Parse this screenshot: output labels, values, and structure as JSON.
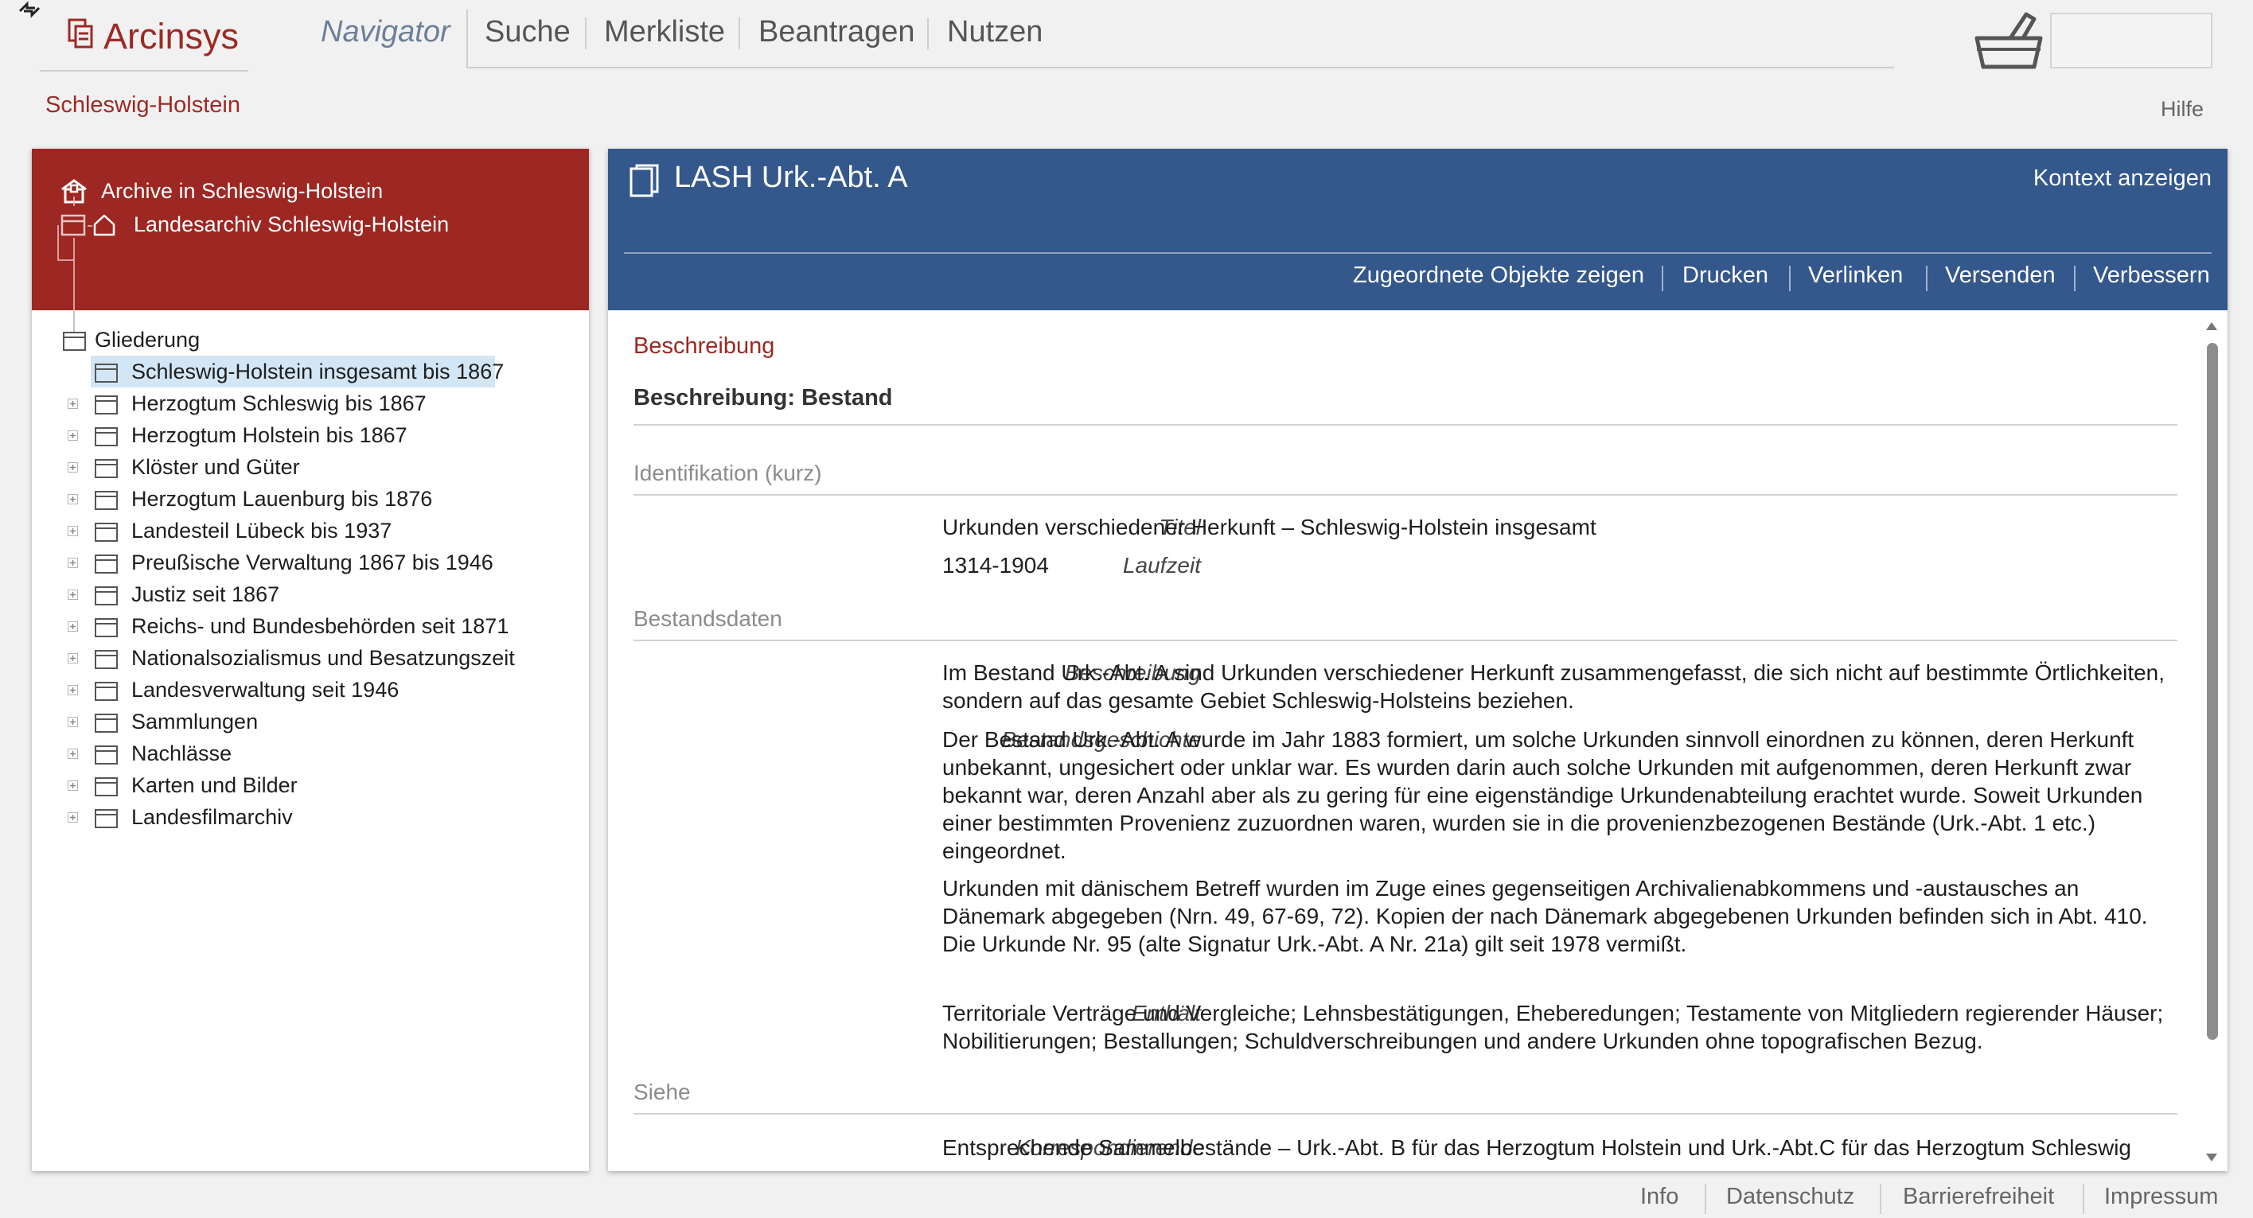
{
  "header": {
    "app_title": "Arcinsys",
    "region": "Schleswig-Holstein",
    "help": "Hilfe",
    "nav": {
      "navigator": "Navigator",
      "suche": "Suche",
      "merkliste": "Merkliste",
      "beantragen": "Beantragen",
      "nutzen": "Nutzen"
    }
  },
  "left_panel": {
    "archive_title": "Archive in Schleswig-Holstein",
    "landesarchiv": "Landesarchiv Schleswig-Holstein",
    "tree_root": "Gliederung",
    "tree_items": [
      "Schleswig-Holstein insgesamt bis 1867",
      "Herzogtum Schleswig bis 1867",
      "Herzogtum Holstein bis 1867",
      "Klöster und Güter",
      "Herzogtum Lauenburg bis 1876",
      "Landesteil Lübeck bis 1937",
      "Preußische Verwaltung 1867 bis 1946",
      "Justiz seit 1867",
      "Reichs- und Bundesbehörden seit 1871",
      "Nationalsozialismus und Besatzungszeit",
      "Landesverwaltung seit 1946",
      "Sammlungen",
      "Nachlässe",
      "Karten und Bilder",
      "Landesfilmarchiv"
    ]
  },
  "right_panel": {
    "title": "LASH Urk.-Abt. A",
    "context_link": "Kontext anzeigen",
    "actions": {
      "objects": "Zugeordnete Objekte zeigen",
      "print": "Drucken",
      "link": "Verlinken",
      "send": "Versenden",
      "improve": "Verbessern"
    },
    "section_title": "Beschreibung",
    "description_heading": "Beschreibung: Bestand",
    "groups": {
      "identification": "Identifikation (kurz)",
      "stock_data": "Bestandsdaten",
      "see": "Siehe"
    },
    "fields": {
      "titel": {
        "label": "Titel",
        "value": "Urkunden verschiedener Herkunft – Schleswig-Holstein insgesamt"
      },
      "laufzeit": {
        "label": "Laufzeit",
        "value": "1314-1904"
      },
      "beschreibung": {
        "label": "Beschreibung",
        "value": "Im Bestand Urk.-Abt. A sind Urkunden verschiedener Herkunft zusammengefasst, die sich nicht auf bestimmte Örtlichkeiten, sondern auf das gesamte Gebiet Schleswig-Holsteins beziehen."
      },
      "bestandsgeschichte": {
        "label": "Bestandsgeschichte",
        "paragraph1": "Der Bestand Urk.-Abt. A wurde im Jahr 1883 formiert, um solche Urkunden sinnvoll einordnen zu können, deren Herkunft unbekannt, ungesichert oder unklar war. Es wurden darin auch solche Urkunden mit aufgenommen, deren Herkunft zwar bekannt war, deren Anzahl aber als zu gering für eine eigenständige Urkundenabteilung erachtet wurde. Soweit Urkunden einer bestimmten Provenienz zuzuordnen waren, wurden sie in die provenienzbezogenen Bestände (Urk.-Abt. 1 etc.) eingeordnet.",
        "paragraph2": "Urkunden mit dänischem Betreff wurden im Zuge eines gegenseitigen Archivalienabkommens und -austausches an Dänemark abgegeben (Nrn. 49, 67-69, 72). Kopien der nach Dänemark abgegebenen Urkunden befinden sich in Abt. 410.",
        "paragraph3": "Die Urkunde Nr. 95 (alte Signatur Urk.-Abt. A Nr. 21a) gilt seit 1978 vermißt."
      },
      "enthaelt": {
        "label": "Enthält",
        "value": "Territoriale Verträge und Vergleiche; Lehnsbestätigungen, Eheberedungen; Testamente von Mitgliedern regierender Häuser; Nobilitierungen; Bestallungen; Schuldverschreibungen und andere Urkunden ohne topografischen Bezug."
      },
      "korrespondierende": {
        "label": "Korrespondierende",
        "value": "Entsprechende Sammelbestände – Urk.-Abt. B für das Herzogtum Holstein und Urk.-Abt.C für das Herzogtum Schleswig"
      }
    }
  },
  "footer": {
    "info": "Info",
    "privacy": "Datenschutz",
    "accessibility": "Barrierefreiheit",
    "imprint": "Impressum"
  },
  "colors": {
    "brand_red": "#9d2722",
    "panel_blue": "#34578c",
    "selection": "#d3e6f5",
    "navigator_active": "#6d7f99"
  },
  "icons": [
    "cursor-icon",
    "arcinsys-logo-icon",
    "basket-icon",
    "archive-icon",
    "folder-icon",
    "home-icon",
    "expand-plus-icon",
    "record-icon",
    "scroll-up-icon",
    "scroll-down-icon"
  ]
}
